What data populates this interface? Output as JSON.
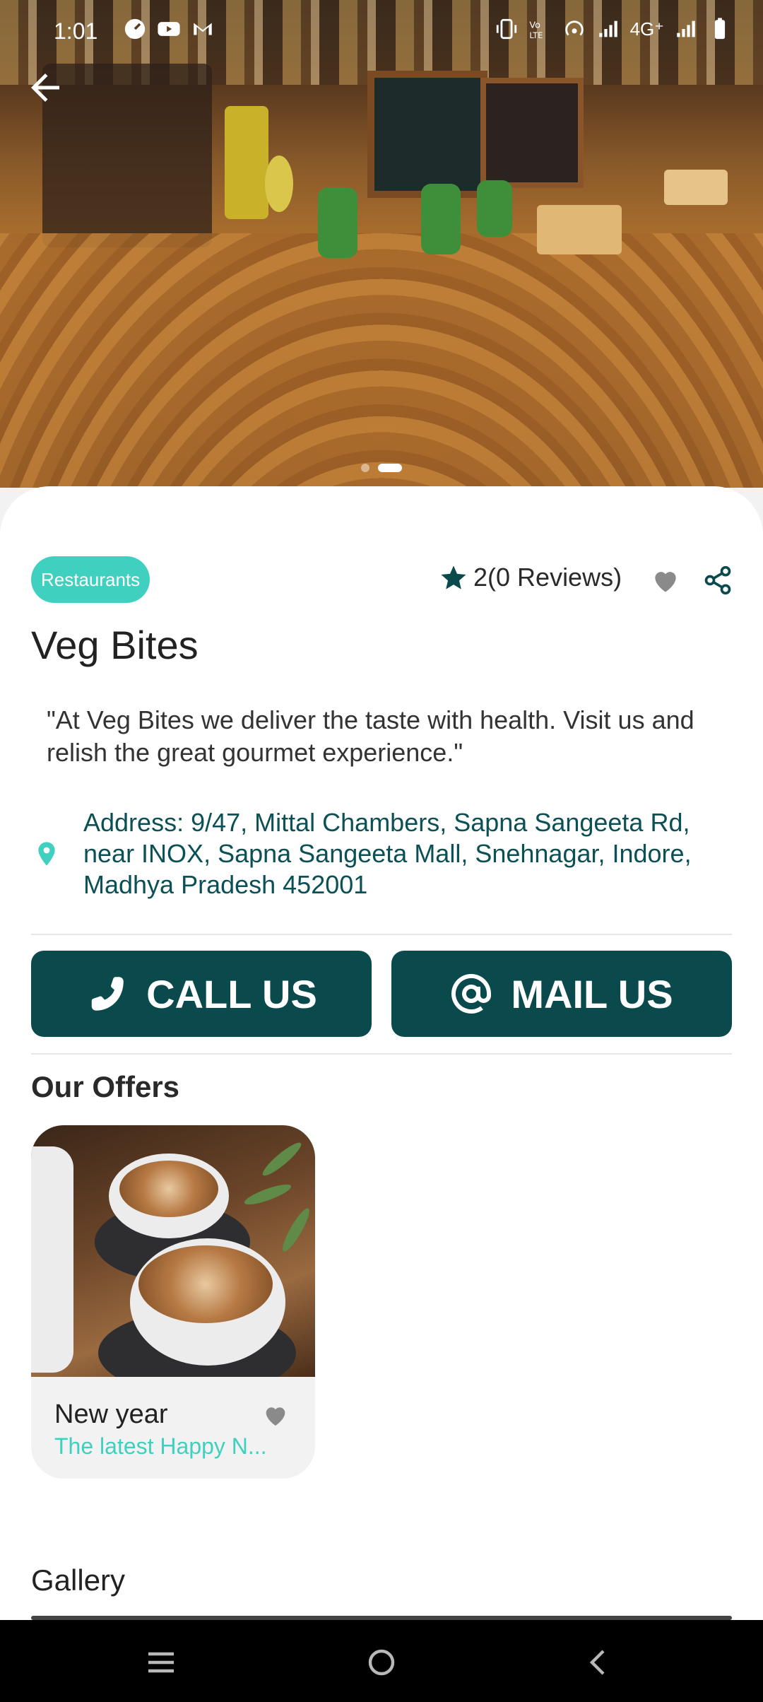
{
  "status_bar": {
    "time": "1:01",
    "left_icons": [
      "speedometer-icon",
      "youtube-icon",
      "gmail-icon"
    ],
    "right_icons": [
      "vibrate-icon",
      "volte-icon",
      "hotspot-icon",
      "signal-icon",
      "signal-icon",
      "battery-icon"
    ],
    "network_label": "4G⁺"
  },
  "hero": {
    "carousel_page_count": 2,
    "carousel_active_index": 1
  },
  "place": {
    "category": "Restaurants",
    "rating": "2",
    "reviews": "(0 Reviews)",
    "name": "Veg Bites",
    "description": "\"At Veg Bites we deliver the taste with health. Visit us and relish the great gourmet experience.\"",
    "address": "Address: 9/47, Mittal Chambers, Sapna Sangeeta Rd, near INOX, Sapna Sangeeta Mall, Snehnagar, Indore, Madhya Pradesh 452001"
  },
  "actions": {
    "call_label": "CALL US",
    "mail_label": "MAIL US"
  },
  "offers": {
    "heading": "Our Offers",
    "items": [
      {
        "title": "New year",
        "subtitle": "The latest Happy N..."
      }
    ]
  },
  "gallery": {
    "heading": "Gallery"
  },
  "colors": {
    "primary_dark": "#0b4a4c",
    "accent_teal": "#3fd0bf",
    "address_text": "#0b5054",
    "favorite_gray": "#8a8a8a"
  }
}
